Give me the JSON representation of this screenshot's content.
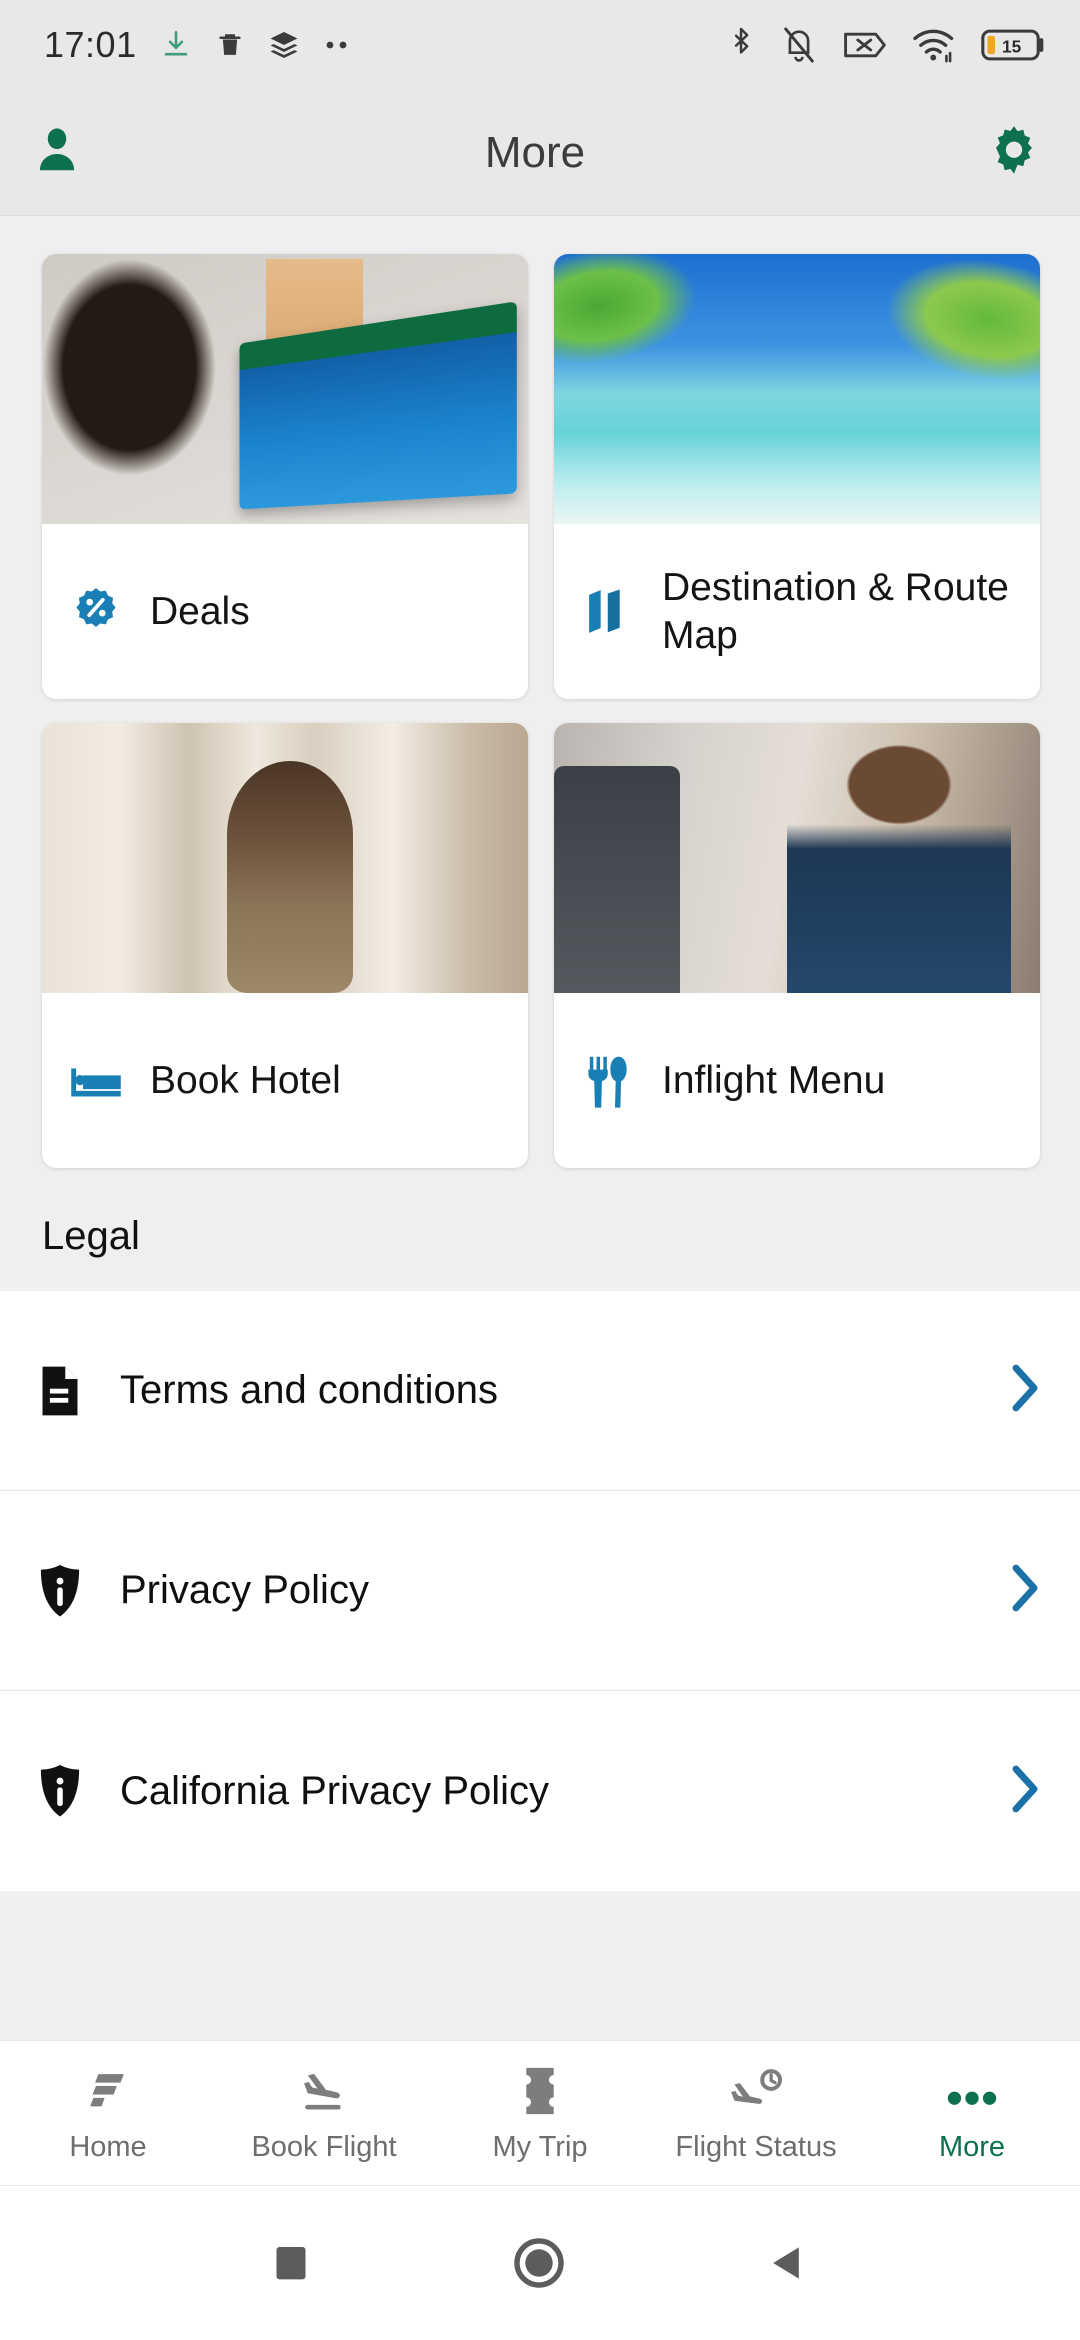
{
  "status_bar": {
    "time": "17:01",
    "left_icons": [
      "download-icon",
      "trash-icon",
      "layers-icon",
      "more-dots-icon"
    ],
    "right_icons": [
      "bluetooth-icon",
      "notifications-muted-icon",
      "sim-card-missing-icon",
      "wifi-icon"
    ],
    "battery_percent": "15"
  },
  "app_bar": {
    "title": "More",
    "profile_icon": "person-icon",
    "settings_icon": "gear-icon",
    "icon_color": "#0d7050"
  },
  "cards": [
    {
      "label": "Deals",
      "icon": "discount-badge-icon",
      "image": "woman-on-laptop-booking"
    },
    {
      "label": "Destination & Route Map",
      "icon": "folded-map-icon",
      "image": "tropical-beach-palms"
    },
    {
      "label": "Book Hotel",
      "icon": "bed-icon",
      "image": "woman-opening-hotel-curtains"
    },
    {
      "label": "Inflight Menu",
      "icon": "fork-knife-icon",
      "image": "passengers-in-cabin"
    }
  ],
  "legal": {
    "heading": "Legal",
    "items": [
      {
        "label": "Terms and conditions",
        "icon": "document-icon"
      },
      {
        "label": "Privacy Policy",
        "icon": "shield-info-icon"
      },
      {
        "label": "California Privacy Policy",
        "icon": "shield-info-icon"
      }
    ],
    "chevron_color": "#1a72a8",
    "icon_color": "#111111"
  },
  "bottom_nav": {
    "items": [
      {
        "label": "Home",
        "icon": "frontier-f-logo-icon",
        "active": false
      },
      {
        "label": "Book Flight",
        "icon": "plane-landing-icon",
        "active": false
      },
      {
        "label": "My Trip",
        "icon": "ticket-icon",
        "active": false
      },
      {
        "label": "Flight Status",
        "icon": "plane-clock-icon",
        "active": false
      },
      {
        "label": "More",
        "icon": "ellipsis-icon",
        "active": true
      }
    ],
    "active_color": "#0d7050",
    "inactive_color": "#6e6e6e"
  },
  "android_nav": {
    "buttons": [
      "recents-square-icon",
      "home-circle-icon",
      "back-triangle-icon"
    ]
  },
  "theme": {
    "accent_blue": "#1a7fb5",
    "accent_green": "#0d7050",
    "page_background": "#efefef",
    "card_background": "#ffffff"
  }
}
